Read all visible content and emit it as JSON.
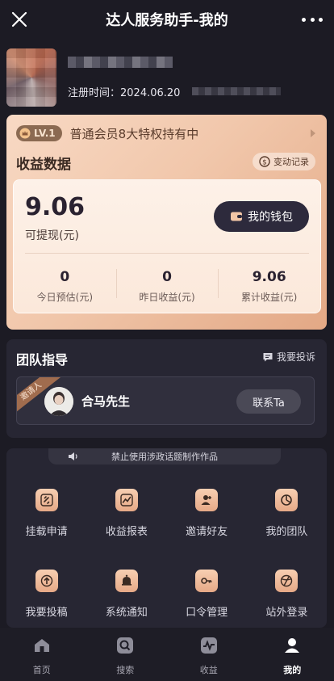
{
  "topbar": {
    "title": "达人服务助手-我的"
  },
  "profile": {
    "registered_label": "注册时间：",
    "registered_date": "2024.06.20"
  },
  "earnings": {
    "level_badge": "LV.1",
    "member_text": "普通会员8大特权持有中",
    "section_title": "收益数据",
    "change_log_label": "变动记录",
    "balance": "9.06",
    "balance_label": "可提现(元)",
    "wallet_button": "我的钱包",
    "stats": [
      {
        "value": "0",
        "label": "今日预估(元)"
      },
      {
        "value": "0",
        "label": "昨日收益(元)"
      },
      {
        "value": "9.06",
        "label": "累计收益(元)"
      }
    ]
  },
  "team": {
    "title": "团队指导",
    "complain_label": "我要投诉",
    "inviter_tag": "邀请人",
    "inviter_name": "合马先生",
    "contact_button": "联系Ta"
  },
  "functions": {
    "notice": "禁止使用涉政话题制作作品",
    "items": [
      {
        "label": "挂载申请",
        "icon": "link-icon"
      },
      {
        "label": "收益报表",
        "icon": "chart-icon"
      },
      {
        "label": "邀请好友",
        "icon": "add-user-icon"
      },
      {
        "label": "我的团队",
        "icon": "team-pie-icon"
      },
      {
        "label": "我要投稿",
        "icon": "upload-icon"
      },
      {
        "label": "系统通知",
        "icon": "bell-icon"
      },
      {
        "label": "口令管理",
        "icon": "key-icon"
      },
      {
        "label": "站外登录",
        "icon": "external-login-icon"
      }
    ]
  },
  "tabbar": {
    "items": [
      {
        "label": "首页",
        "icon": "home-icon"
      },
      {
        "label": "搜索",
        "icon": "search-icon"
      },
      {
        "label": "收益",
        "icon": "earnings-icon"
      },
      {
        "label": "我的",
        "icon": "profile-icon"
      }
    ],
    "active_index": 3
  },
  "colors": {
    "background": "#1c1b24",
    "card": "#272633",
    "accent_gradient_start": "#f8d9c4",
    "accent_gradient_end": "#e3a885",
    "wallet_button": "#2d2a3c"
  }
}
